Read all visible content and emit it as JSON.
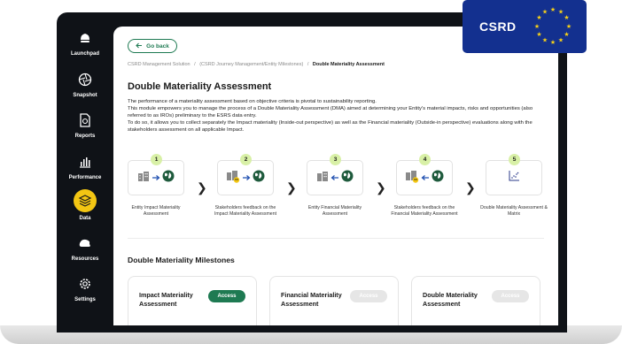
{
  "badge": {
    "label": "CSRD"
  },
  "sidebar": {
    "items": [
      {
        "label": "Launchpad",
        "icon": "rocket-icon",
        "active": false
      },
      {
        "label": "Snapshot",
        "icon": "aperture-icon",
        "active": false
      },
      {
        "label": "Reports",
        "icon": "report-icon",
        "active": false
      },
      {
        "label": "Performance",
        "icon": "bar-chart-icon",
        "active": false
      },
      {
        "label": "Data",
        "icon": "layers-icon",
        "active": true
      },
      {
        "label": "Resources",
        "icon": "cloud-icon",
        "active": false
      },
      {
        "label": "Settings",
        "icon": "gear-icon",
        "active": false
      }
    ]
  },
  "header": {
    "back_label": "Go back",
    "breadcrumb": {
      "item1": "CSRD Management Solution",
      "sep": "/",
      "item2": "(CSRD Journey Management/Entity Milestones)",
      "current": "Double Materiality Assessment"
    }
  },
  "main": {
    "title": "Double Materiality Assessment",
    "description": [
      "The performance of a materiality assessment based on objective criteria is pivotal to sustainability reporting.",
      "This module empowers you to manage the process of a Double Materiality Assessment (DMA) aimed at determining your Entity's material impacts, risks and opportunities (also referred to as IROs) preliminary to the ESRS data entry.",
      "To do so, it allows you to collect separately the Impact materiality (Inside-out perspective) as well as the Financial materiality (Outside-in perspective) evaluations along with the stakeholders assessment on all applicable Impact."
    ],
    "steps": [
      {
        "num": "1",
        "label": "Entity Impact Materiality Assessment"
      },
      {
        "num": "2",
        "label": "Stakeholders feedback on the Impact Materiality Assessment"
      },
      {
        "num": "3",
        "label": "Entity Financial Materiality Assessment"
      },
      {
        "num": "4",
        "label": "Stakeholders feedback on the Financial Materiality Assessment"
      },
      {
        "num": "5",
        "label": "Double Materiality Assessment & Matrix"
      }
    ],
    "milestones_title": "Double Materiality Milestones",
    "cards": [
      {
        "title": "Impact Materiality Assessment",
        "access_label": "Access",
        "enabled": true
      },
      {
        "title": "Financial Materiality Assessment",
        "access_label": "Access",
        "enabled": false
      },
      {
        "title": "Double Materiality Assessment",
        "access_label": "Access",
        "enabled": false
      }
    ]
  },
  "colors": {
    "accent_green": "#1e7a52",
    "active_yellow": "#f3c613",
    "step_badge": "#d8f0a6",
    "eu_blue": "#13308f",
    "eu_star": "#f7d117"
  }
}
